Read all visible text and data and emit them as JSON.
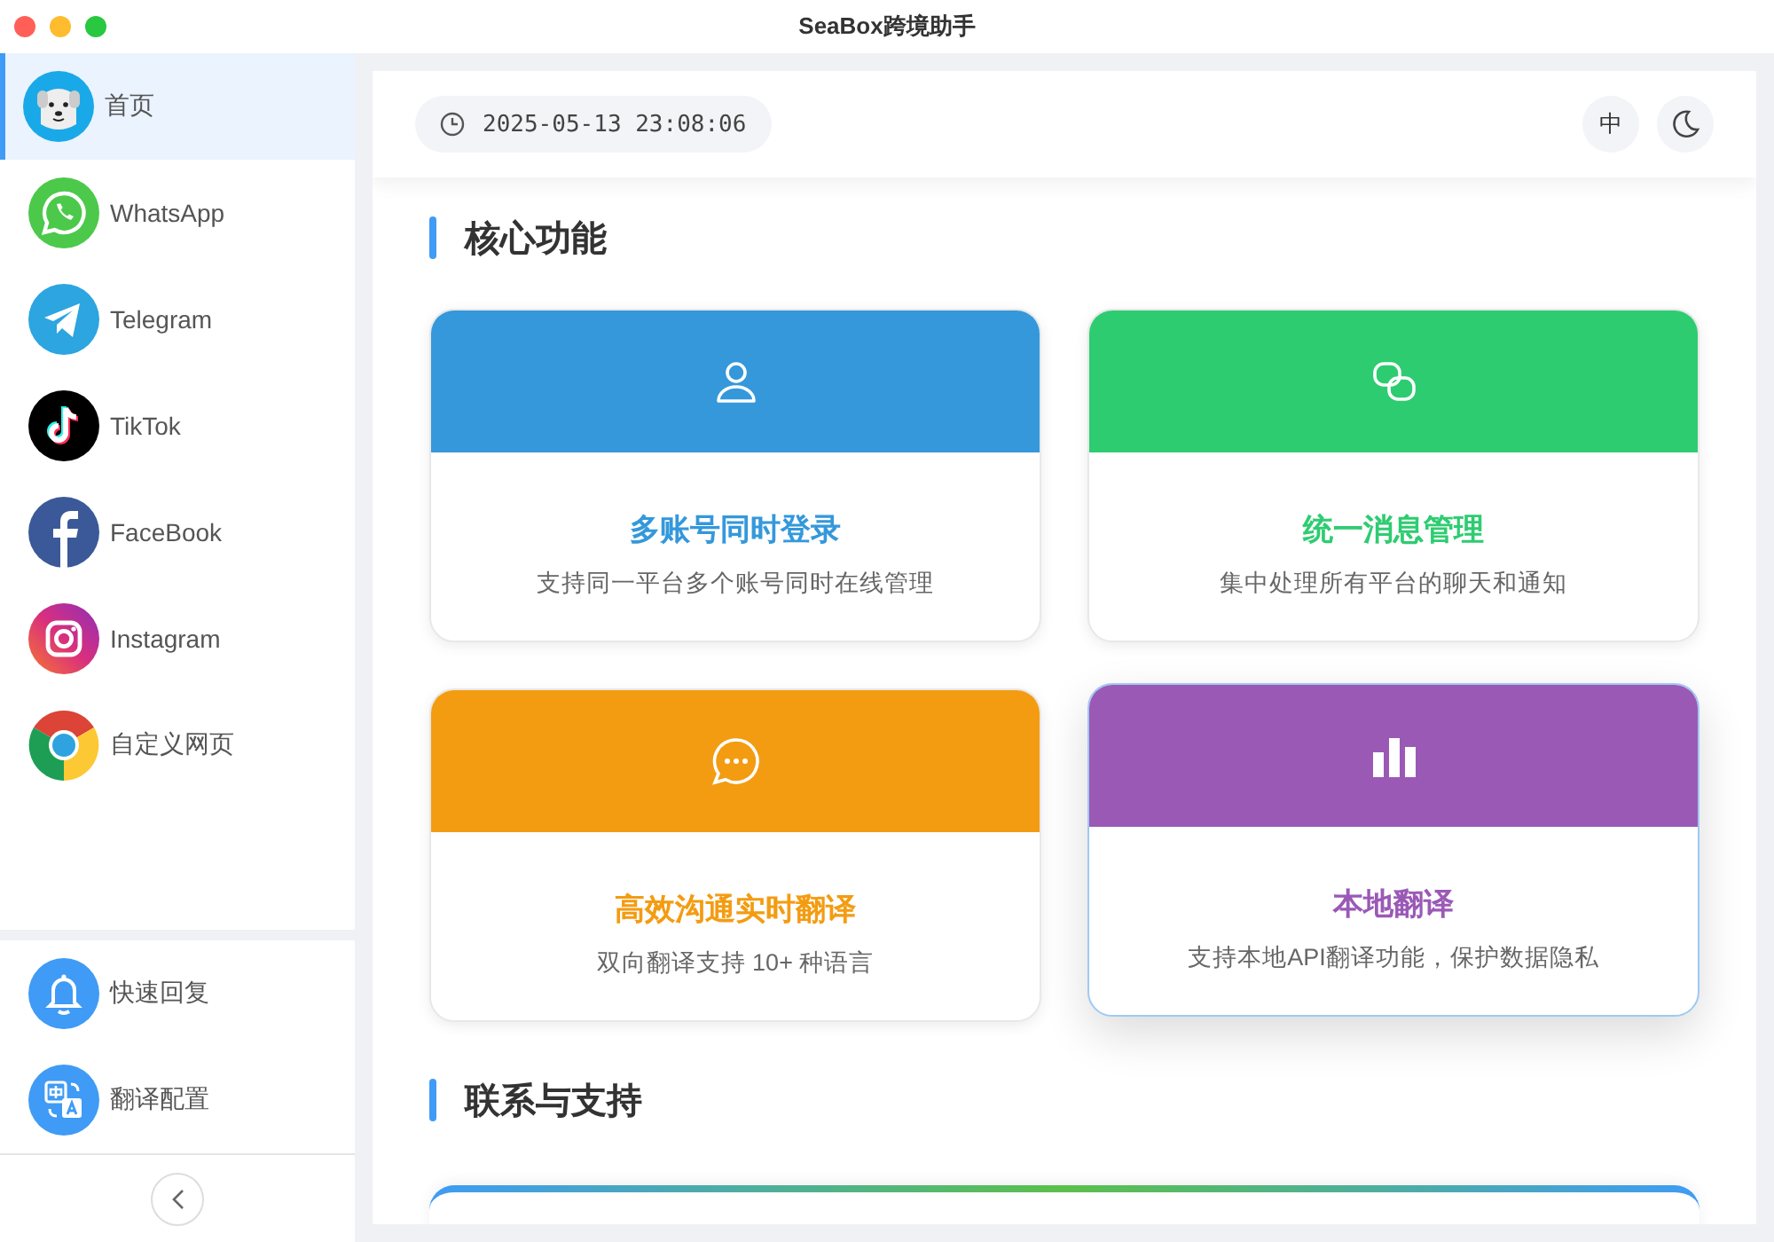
{
  "window": {
    "title": "SeaBox跨境助手"
  },
  "sidebar": {
    "items": [
      {
        "label": "首页",
        "selected": true
      },
      {
        "label": "WhatsApp",
        "selected": false
      },
      {
        "label": "Telegram",
        "selected": false
      },
      {
        "label": "TikTok",
        "selected": false
      },
      {
        "label": "FaceBook",
        "selected": false
      },
      {
        "label": "Instagram",
        "selected": false
      },
      {
        "label": "自定义网页",
        "selected": false
      }
    ],
    "tools": [
      {
        "label": "快速回复",
        "selected": false
      },
      {
        "label": "翻译配置",
        "selected": false
      }
    ]
  },
  "header": {
    "datetime": "2025-05-13 23:08:06",
    "language_button": "中"
  },
  "sections": [
    {
      "title": "核心功能",
      "cards": [
        {
          "title": "多账号同时登录",
          "description": "支持同一平台多个账号同时在线管理",
          "color": "#3498db",
          "hovered": false
        },
        {
          "title": "统一消息管理",
          "description": "集中处理所有平台的聊天和通知",
          "color": "#2ecc71",
          "hovered": false
        },
        {
          "title": "高效沟通实时翻译",
          "description": "双向翻译支持 10+ 种语言",
          "color": "#f39c12",
          "hovered": false
        },
        {
          "title": "本地翻译",
          "description": "支持本地API翻译功能，保护数据隐私",
          "color": "#9b59b6",
          "hovered": true
        }
      ]
    },
    {
      "title": "联系与支持"
    }
  ]
}
